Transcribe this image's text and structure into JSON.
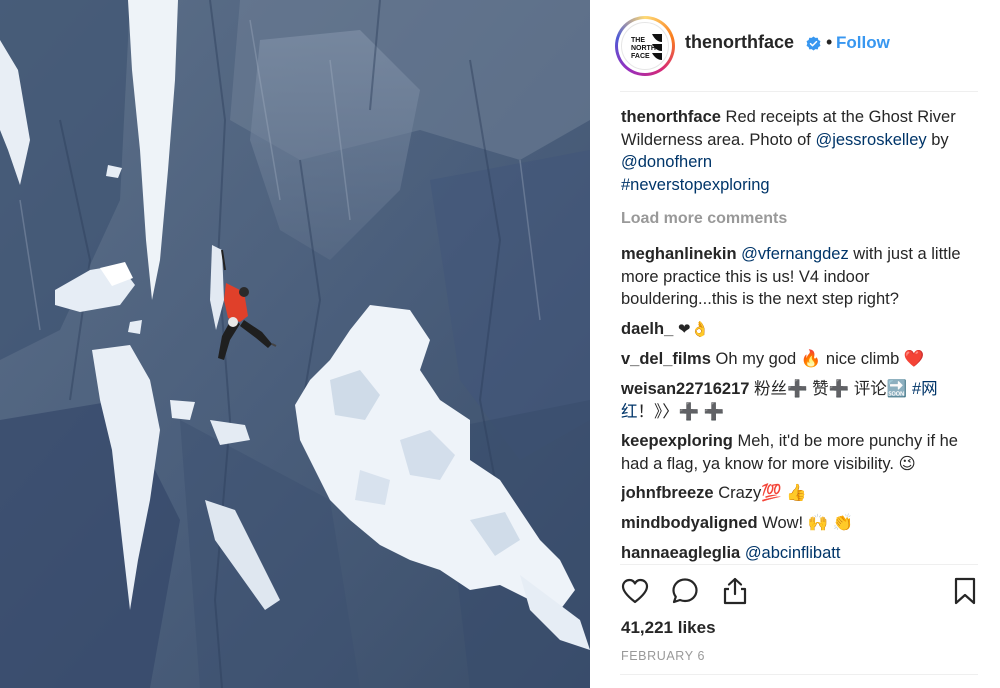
{
  "post": {
    "username": "thenorthface",
    "follow_label": "Follow",
    "separator": "•",
    "avatar_text": [
      "THE",
      "NORTH",
      "FACE"
    ],
    "caption": {
      "username": "thenorthface",
      "text_1": "Red receipts at the Ghost River Wilderness area. Photo of",
      "mention_1": "@jessroskelley",
      "text_2": "by",
      "mention_2": "@donofhern",
      "hashtag": "#neverstopexploring"
    },
    "load_more": "Load more comments",
    "comments": [
      {
        "user": "meghanlinekin",
        "mention": "@vfernangdez",
        "text": "with just a little more practice this is us! V4 indoor bouldering...this is the next step right?"
      },
      {
        "user": "daelh_",
        "text": "❤👌"
      },
      {
        "user": "v_del_films",
        "text": "Oh my god 🔥  nice climb ❤️"
      },
      {
        "user": "weisan22716217",
        "text": "粉丝➕ 赞➕ 评论🔜",
        "hashtag": "#网红",
        "text_2": "！》〉➕ ➕"
      },
      {
        "user": "keepexploring",
        "text": "Meh, it'd be more punchy if he had a flag, ya know for more visibility. 😉"
      },
      {
        "user": "johnfbreeze",
        "text": "Crazy💯 👍"
      },
      {
        "user": "mindbodyaligned",
        "text": "Wow! 🙌 👏"
      },
      {
        "user": "hannaeagleglia",
        "text": "@abcinflibatt"
      }
    ],
    "likes": "41,221 likes",
    "date": "FEBRUARY 6"
  },
  "icons": {
    "like": "heart-icon",
    "comment": "comment-icon",
    "share": "share-icon",
    "save": "bookmark-icon",
    "verified": "verified-badge-icon"
  },
  "colors": {
    "link": "#003569",
    "follow": "#3897f0",
    "verified": "#3897f0",
    "muted": "#999999",
    "climber_jacket": "#e0402a"
  }
}
